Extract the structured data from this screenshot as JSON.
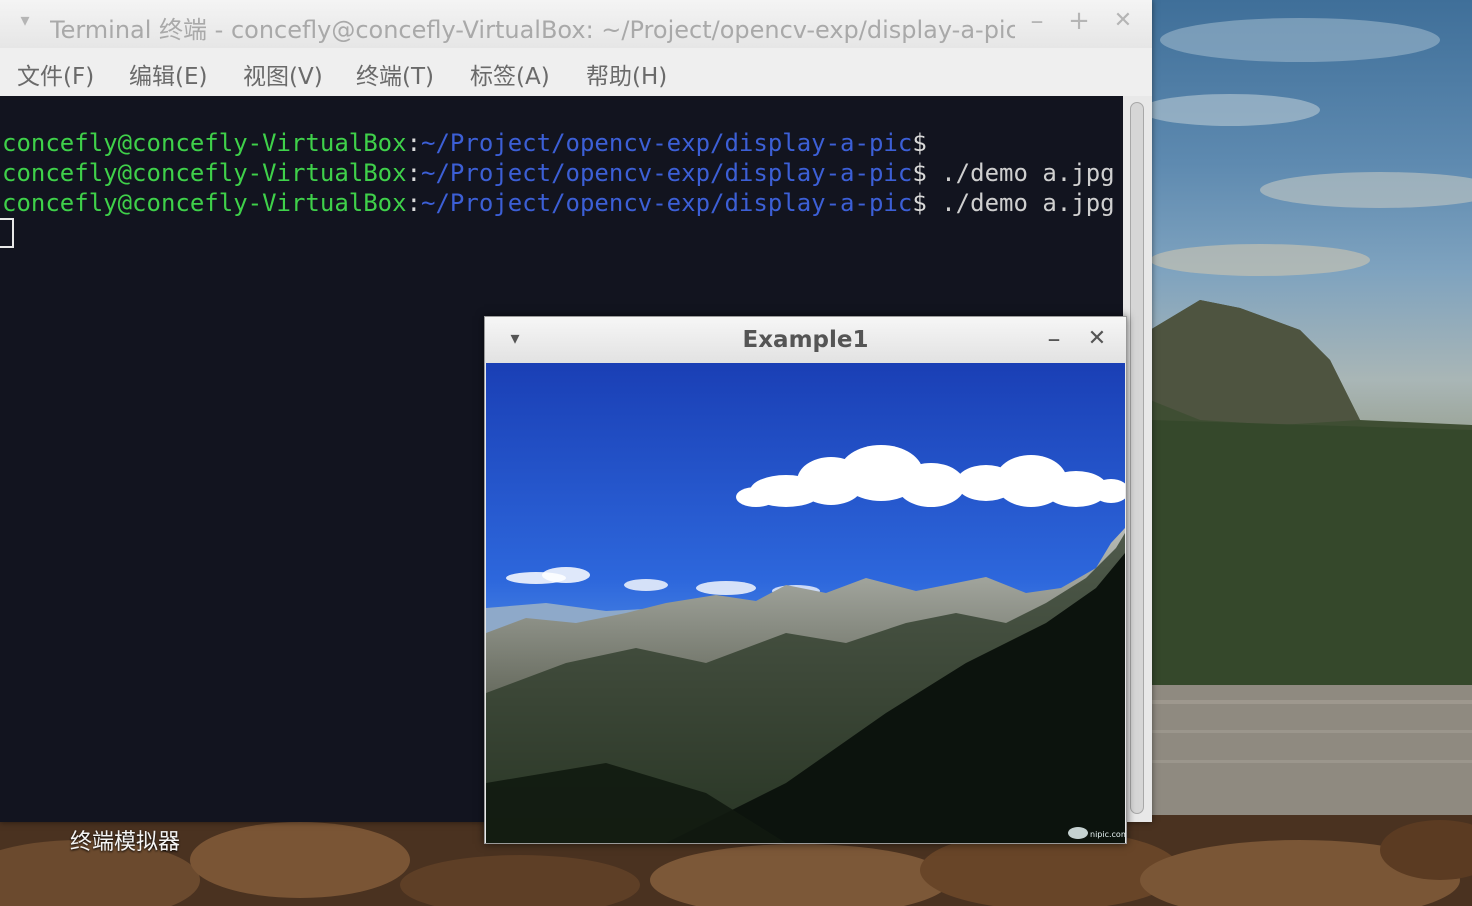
{
  "desktop": {
    "launcher_label": "终端模拟器"
  },
  "terminal": {
    "title": "Terminal 终端 - concefly@concefly-VirtualBox: ~/Project/opencv-exp/display-a-pic",
    "menu": [
      "文件(F)",
      "编辑(E)",
      "视图(V)",
      "终端(T)",
      "标签(A)",
      "帮助(H)"
    ],
    "lines": [
      {
        "user": "concefly@concefly-VirtualBox",
        "sep": ":",
        "path": "~/Project/opencv-exp/display-a-pic",
        "dollar": "$",
        "cmd": ""
      },
      {
        "user": "concefly@concefly-VirtualBox",
        "sep": ":",
        "path": "~/Project/opencv-exp/display-a-pic",
        "dollar": "$",
        "cmd": " ./demo a.jpg"
      },
      {
        "user": "concefly@concefly-VirtualBox",
        "sep": ":",
        "path": "~/Project/opencv-exp/display-a-pic",
        "dollar": "$",
        "cmd": " ./demo a.jpg"
      }
    ],
    "buttons": {
      "minimize": "–",
      "maximize": "+",
      "close": "✕"
    },
    "colors": {
      "background": "#12141f",
      "user": "#3fd14a",
      "path": "#3c5fd6"
    }
  },
  "image_window": {
    "title": "Example1",
    "buttons": {
      "menu": "▾",
      "minimize": "–",
      "close": "✕"
    },
    "watermark": "nipic.com"
  }
}
